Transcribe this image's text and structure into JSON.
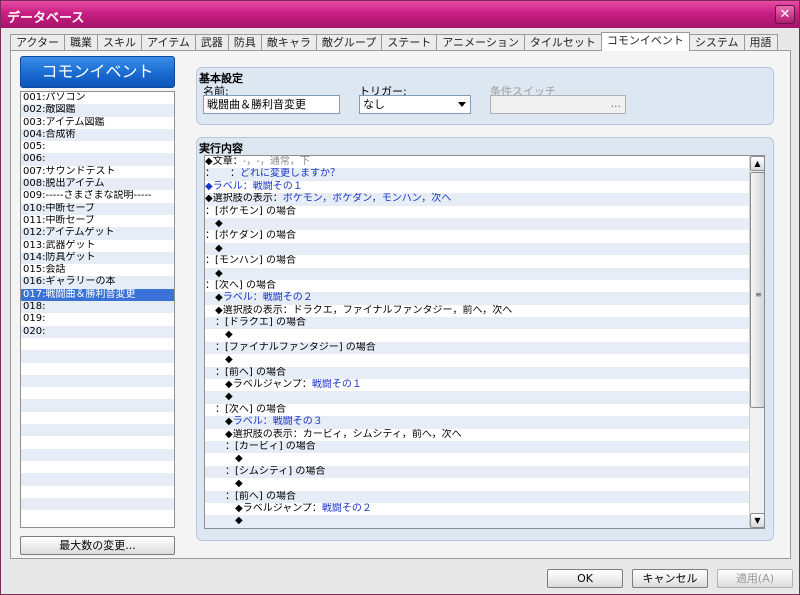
{
  "window": {
    "title": "データベース",
    "close": "✕"
  },
  "tabs": [
    "アクター",
    "職業",
    "スキル",
    "アイテム",
    "武器",
    "防具",
    "敵キャラ",
    "敵グループ",
    "ステート",
    "アニメーション",
    "タイルセット",
    "コモンイベント",
    "システム",
    "用語"
  ],
  "active_tab": 11,
  "left": {
    "header": "コモンイベント",
    "items": [
      "001:パソコン",
      "002:敵図鑑",
      "003:アイテム図鑑",
      "004:合成術",
      "005:",
      "006:",
      "007:サウンドテスト",
      "008:脱出アイテム",
      "009:-----さまざまな説明-----",
      "010:中断セーブ",
      "011:中断セーブ",
      "012:アイテムゲット",
      "013:武器ゲット",
      "014:防具ゲット",
      "015:会話",
      "016:ギャラリーの本",
      "017:戦闘曲＆勝利音変更",
      "018:",
      "019:",
      "020:"
    ],
    "selected_index": 16,
    "max_button": "最大数の変更..."
  },
  "basic": {
    "title": "基本設定",
    "name_label": "名前:",
    "name_value": "戦闘曲＆勝利音変更",
    "trigger_label": "トリガー:",
    "trigger_value": "なし",
    "switch_label": "条件スイッチ",
    "switch_dots": "..."
  },
  "exec": {
    "title": "実行内容",
    "lines": [
      [
        {
          "t": "◆文章：",
          "c": "cmd"
        },
        {
          "t": "-，-，通常，下",
          "c": "gray"
        }
      ],
      [
        {
          "t": "：　　：",
          "c": "cmd"
        },
        {
          "t": "どれに変更しますか？",
          "c": "blue"
        }
      ],
      [
        {
          "t": "◆ラベル：",
          "c": "blue"
        },
        {
          "t": "戦闘その１",
          "c": "blue"
        }
      ],
      [
        {
          "t": "◆選択肢の表示：",
          "c": "cmd"
        },
        {
          "t": "ポケモン，ポケダン，モンハン，次へ",
          "c": "blue"
        }
      ],
      [
        {
          "t": "：[ポケモン] の場合",
          "c": "cmd"
        }
      ],
      [
        {
          "t": "　◆",
          "c": "cmd"
        }
      ],
      [
        {
          "t": "：[ポケダン] の場合",
          "c": "cmd"
        }
      ],
      [
        {
          "t": "　◆",
          "c": "cmd"
        }
      ],
      [
        {
          "t": "：[モンハン] の場合",
          "c": "cmd"
        }
      ],
      [
        {
          "t": "　◆",
          "c": "cmd"
        }
      ],
      [
        {
          "t": "：[次へ] の場合",
          "c": "cmd"
        }
      ],
      [
        {
          "t": "　◆",
          "c": "cmd"
        },
        {
          "t": "ラベル：戦闘その２",
          "c": "blue"
        }
      ],
      [
        {
          "t": "　◆選択肢の表示：ドラクエ，ファイナルファンタジー，前へ，次へ",
          "c": "cmd"
        }
      ],
      [
        {
          "t": "　：[ドラクエ] の場合",
          "c": "cmd"
        }
      ],
      [
        {
          "t": "　　◆",
          "c": "cmd"
        }
      ],
      [
        {
          "t": "　：[ファイナルファンタジー] の場合",
          "c": "cmd"
        }
      ],
      [
        {
          "t": "　　◆",
          "c": "cmd"
        }
      ],
      [
        {
          "t": "　：[前へ] の場合",
          "c": "cmd"
        }
      ],
      [
        {
          "t": "　　◆ラベルジャンプ：",
          "c": "cmd"
        },
        {
          "t": "戦闘その１",
          "c": "blue"
        }
      ],
      [
        {
          "t": "　　◆",
          "c": "cmd"
        }
      ],
      [
        {
          "t": "　：[次へ] の場合",
          "c": "cmd"
        }
      ],
      [
        {
          "t": "　　◆",
          "c": "cmd"
        },
        {
          "t": "ラベル：戦闘その３",
          "c": "blue"
        }
      ],
      [
        {
          "t": "　　◆選択肢の表示：カービィ，シムシティ，前へ，次へ",
          "c": "cmd"
        }
      ],
      [
        {
          "t": "　　：[カービィ] の場合",
          "c": "cmd"
        }
      ],
      [
        {
          "t": "　　　◆",
          "c": "cmd"
        }
      ],
      [
        {
          "t": "　　：[シムシティ] の場合",
          "c": "cmd"
        }
      ],
      [
        {
          "t": "　　　◆",
          "c": "cmd"
        }
      ],
      [
        {
          "t": "　　：[前へ] の場合",
          "c": "cmd"
        }
      ],
      [
        {
          "t": "　　　◆ラベルジャンプ：",
          "c": "cmd"
        },
        {
          "t": "戦闘その２",
          "c": "blue"
        }
      ],
      [
        {
          "t": "　　　◆",
          "c": "cmd"
        }
      ]
    ]
  },
  "footer": {
    "ok": "OK",
    "cancel": "キャンセル",
    "apply": "適用(A)"
  },
  "scroll": {
    "up": "▲",
    "down": "▼",
    "grip": "≡"
  }
}
